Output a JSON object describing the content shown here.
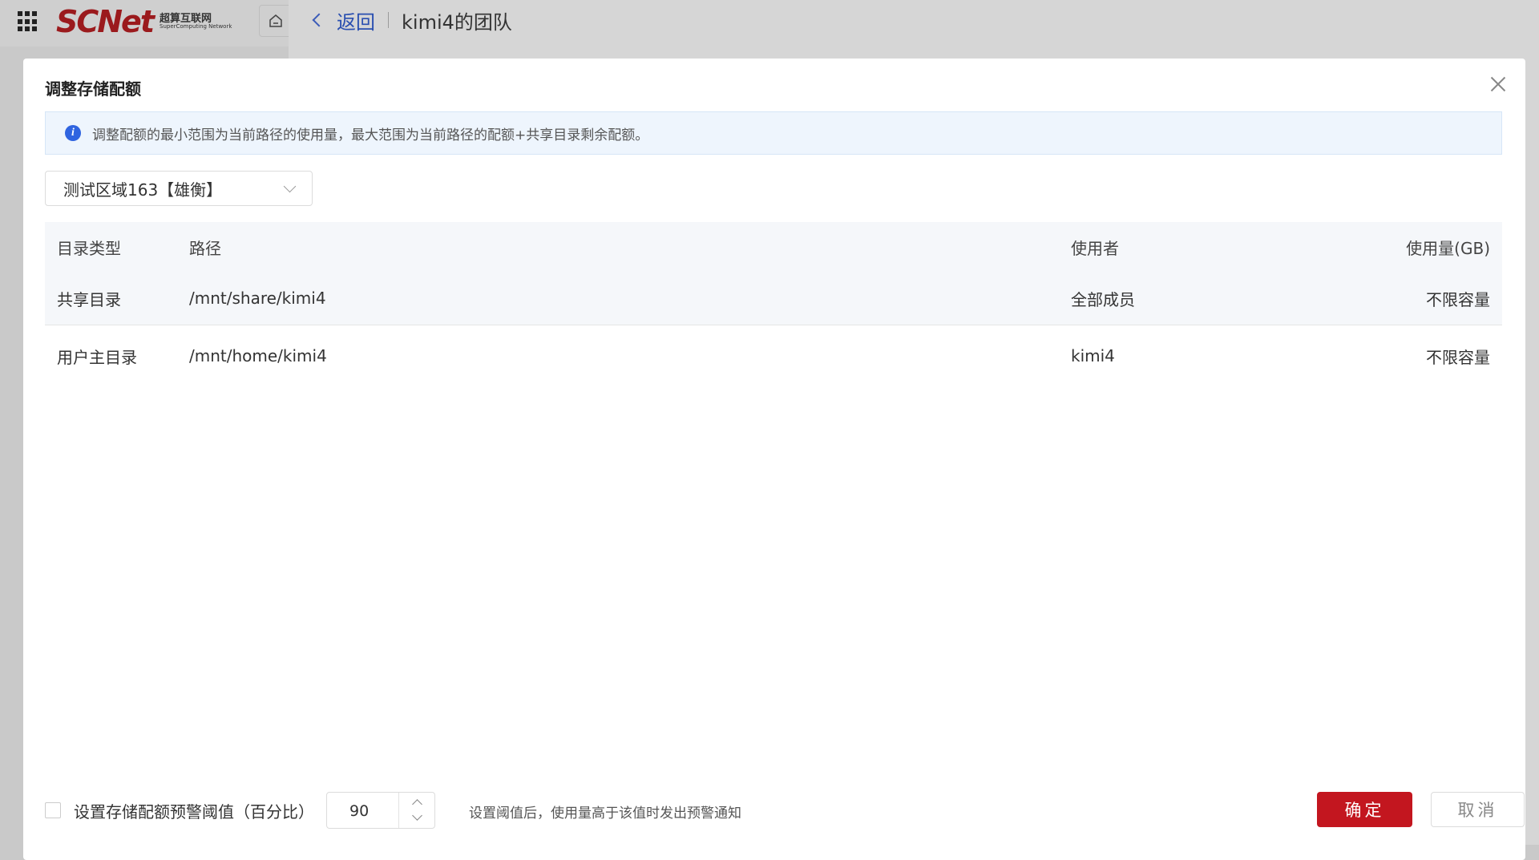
{
  "topbar": {
    "logo_main": "SCNet",
    "logo_cn": "超算互联网",
    "logo_en": "SuperComputing Network"
  },
  "header": {
    "back_label": "返回",
    "team_title": "kimi4的团队"
  },
  "modal": {
    "title": "调整存储配额",
    "info_text": "调整配额的最小范围为当前路径的使用量，最大范围为当前路径的配额+共享目录剩余配额。",
    "region_select": "测试区域163【雄衡】",
    "table": {
      "headers": [
        "目录类型",
        "路径",
        "使用者",
        "使用量(GB)"
      ],
      "rows": [
        {
          "type": "共享目录",
          "path": "/mnt/share/kimi4",
          "user": "全部成员",
          "usage": "不限容量"
        },
        {
          "type": "用户主目录",
          "path": "/mnt/home/kimi4",
          "user": "kimi4",
          "usage": "不限容量"
        }
      ]
    },
    "footer": {
      "threshold_label": "设置存储配额预警阈值（百分比）",
      "threshold_value": "90",
      "hint": "设置阈值后，使用量高于该值时发出预警通知",
      "confirm_label": "确定",
      "cancel_label": "取消"
    }
  },
  "colors": {
    "brand": "#9b1a1d",
    "confirm": "#c3161f",
    "link": "#2a4fb0",
    "info_bg": "#eef5fd"
  }
}
